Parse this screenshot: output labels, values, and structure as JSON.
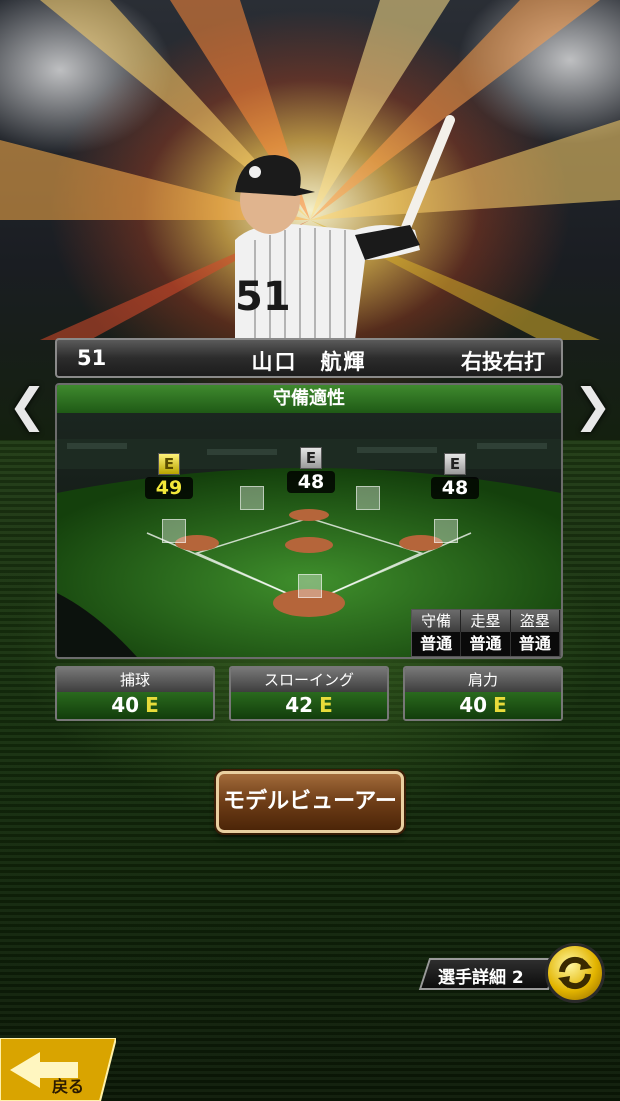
{
  "player": {
    "number": "51",
    "name": "山口　航輝",
    "handedness": "右投右打"
  },
  "defense": {
    "title": "守備適性",
    "positions": [
      {
        "rank": "E",
        "value": "49",
        "highlight": true
      },
      {
        "rank": "E",
        "value": "48",
        "highlight": false
      },
      {
        "rank": "E",
        "value": "48",
        "highlight": false
      }
    ],
    "running": {
      "headers": [
        "守備",
        "走塁",
        "盗塁"
      ],
      "values": [
        "普通",
        "普通",
        "普通"
      ]
    }
  },
  "abilities": [
    {
      "label": "捕球",
      "value": "40",
      "grade": "E"
    },
    {
      "label": "スローイング",
      "value": "42",
      "grade": "E"
    },
    {
      "label": "肩力",
      "value": "40",
      "grade": "E"
    }
  ],
  "buttons": {
    "model_viewer": "モデルビューアー",
    "player_detail": "選手詳細 2",
    "back": "戻る"
  },
  "icons": {
    "prev": "chevron-left-icon",
    "next": "chevron-right-icon",
    "cycle": "cycle-arrows-icon",
    "back": "back-arrow-icon"
  },
  "colors": {
    "panel_green": "#3f8a2e",
    "grade_yellow": "#e8dc3a",
    "button_brown": "#6e3d17"
  }
}
